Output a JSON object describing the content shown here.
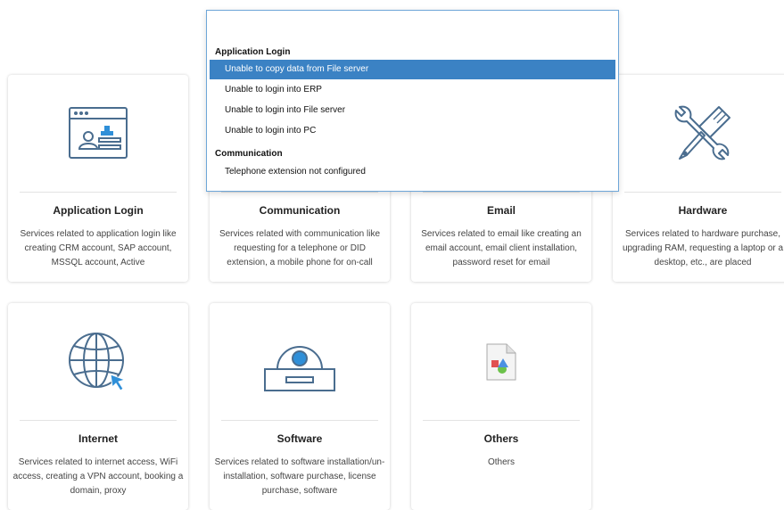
{
  "cards": [
    {
      "title": "Application Login",
      "description": "Services related to application login like creating CRM account, SAP account, MSSQL account, Active",
      "icon": "application-window-icon"
    },
    {
      "title": "Communication",
      "description": "Services related with communication like requesting for a telephone or DID extension, a mobile phone for on-call",
      "icon": "communication-icon"
    },
    {
      "title": "Email",
      "description": "Services related to email like creating an email account, email client installation, password reset for email",
      "icon": "email-icon"
    },
    {
      "title": "Hardware",
      "description": "Services related to hardware purchase, upgrading RAM, requesting a laptop or a desktop, etc., are placed",
      "icon": "wrench-screwdriver-icon"
    },
    {
      "title": "Internet",
      "description": "Services related to internet access, WiFi access, creating a VPN account, booking a domain, proxy",
      "icon": "globe-cursor-icon"
    },
    {
      "title": "Software",
      "description": "Services related to software installation/un-installation, software purchase, license purchase, software",
      "icon": "disc-drive-icon"
    },
    {
      "title": "Others",
      "description": "Others",
      "icon": "shapes-document-icon"
    }
  ],
  "dropdown": {
    "search_value": "",
    "groups": [
      {
        "label": "Application Login",
        "items": [
          {
            "label": "Unable to copy data from File server",
            "selected": true
          },
          {
            "label": "Unable to login into ERP",
            "selected": false
          },
          {
            "label": "Unable to login into File server",
            "selected": false
          },
          {
            "label": "Unable to login into PC",
            "selected": false
          }
        ]
      },
      {
        "label": "Communication",
        "items": [
          {
            "label": "Telephone extension not configured",
            "selected": false
          }
        ]
      }
    ]
  },
  "colors": {
    "accent": "#3b82c4",
    "icon_stroke": "#4a6d8f",
    "icon_accent": "#2f8fd8"
  }
}
